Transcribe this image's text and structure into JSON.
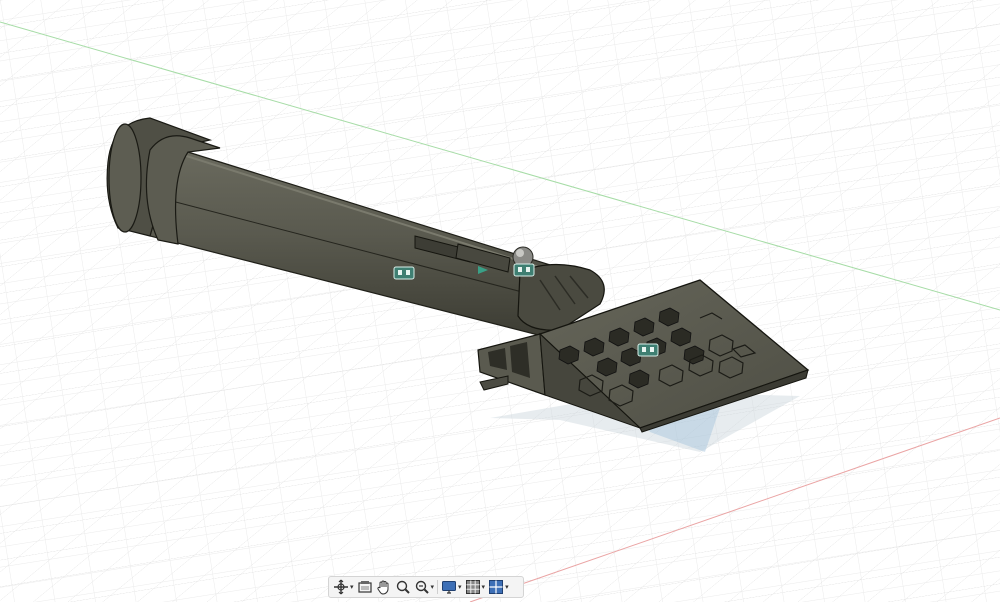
{
  "canvas": {
    "background": "#ffffff",
    "grid_color": "#dcdcdc",
    "grid_major_color": "#c8c8c8",
    "axis_x_color": "#e8a0a0",
    "axis_y_color": "#9fd69f",
    "model_color": "#545449",
    "model_edge_color": "#1a1a14"
  },
  "model": {
    "name": "",
    "parts": [
      "tube",
      "end-cap",
      "collar",
      "hinge-ring",
      "vent-block",
      "honeycomb-panel",
      "sensor-dome"
    ]
  },
  "navigation_bar": {
    "tools": [
      {
        "name": "orbit",
        "icon": "orbit-icon",
        "has_dropdown": true
      },
      {
        "name": "look-at",
        "icon": "look-at-icon",
        "has_dropdown": false
      },
      {
        "name": "pan",
        "icon": "hand-icon",
        "has_dropdown": false
      },
      {
        "name": "zoom",
        "icon": "zoom-icon",
        "has_dropdown": false
      },
      {
        "name": "fit",
        "icon": "fit-zoom-icon",
        "has_dropdown": true
      },
      {
        "name": "display-settings",
        "icon": "display-icon",
        "has_dropdown": true
      },
      {
        "name": "grid-snaps",
        "icon": "grid-icon",
        "has_dropdown": true
      },
      {
        "name": "viewports",
        "icon": "viewports-icon",
        "has_dropdown": true
      }
    ]
  }
}
